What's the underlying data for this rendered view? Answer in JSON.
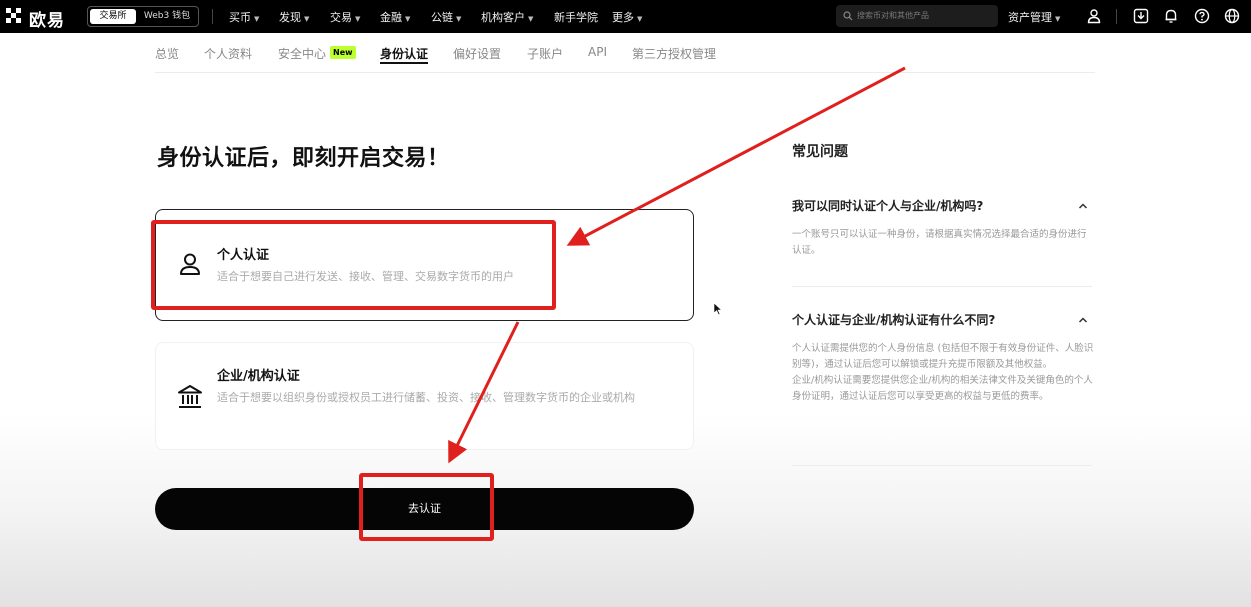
{
  "header": {
    "logo_text": "欧易",
    "mode_exchange": "交易所",
    "mode_web3": "Web3 钱包",
    "nav": [
      {
        "label": "买币"
      },
      {
        "label": "发现"
      },
      {
        "label": "交易"
      },
      {
        "label": "金融"
      },
      {
        "label": "公链"
      },
      {
        "label": "机构客户"
      },
      {
        "label": "新手学院"
      },
      {
        "label": "更多"
      }
    ],
    "search_placeholder": "搜索币对和其他产品",
    "asset_management": "资产管理",
    "icons": [
      "user-icon",
      "download-icon",
      "bell-icon",
      "help-icon",
      "globe-icon"
    ]
  },
  "subtabs": {
    "items": [
      {
        "label": "总览"
      },
      {
        "label": "个人资料"
      },
      {
        "label": "安全中心"
      },
      {
        "label": "身份认证"
      },
      {
        "label": "偏好设置"
      },
      {
        "label": "子账户"
      },
      {
        "label": "API"
      },
      {
        "label": "第三方授权管理"
      }
    ],
    "active": "身份认证",
    "new_badge": "New"
  },
  "main": {
    "headline": "身份认证后，即刻开启交易！",
    "options": [
      {
        "title": "个人认证",
        "description": "适合于想要自己进行发送、接收、管理、交易数字货币的用户",
        "icon": "person-icon",
        "selected": true
      },
      {
        "title": "企业/机构认证",
        "description": "适合于想要以组织身份或授权员工进行储蓄、投资、接收、管理数字货币的企业或机构",
        "icon": "bank-icon",
        "selected": false
      }
    ],
    "button_label": "去认证"
  },
  "faq": {
    "title": "常见问题",
    "items": [
      {
        "question": "我可以同时认证个人与企业/机构吗?",
        "answer": "一个账号只可以认证一种身份，请根据真实情况选择最合适的身份进行认证。"
      },
      {
        "question": "个人认证与企业/机构认证有什么不同?",
        "answer_p1": "个人认证需提供您的个人身份信息 (包括但不限于有效身份证件、人脸识别等)，通过认证后您可以解锁或提升充提币限额及其他权益。",
        "answer_p2": "企业/机构认证需要您提供您企业/机构的相关法律文件及关键角色的个人身份证明，通过认证后您可以享受更高的权益与更低的费率。"
      }
    ]
  },
  "colors": {
    "annotation_red": "#e0201c",
    "new_badge_green": "#bcff2f",
    "primary_button": "#050505"
  }
}
